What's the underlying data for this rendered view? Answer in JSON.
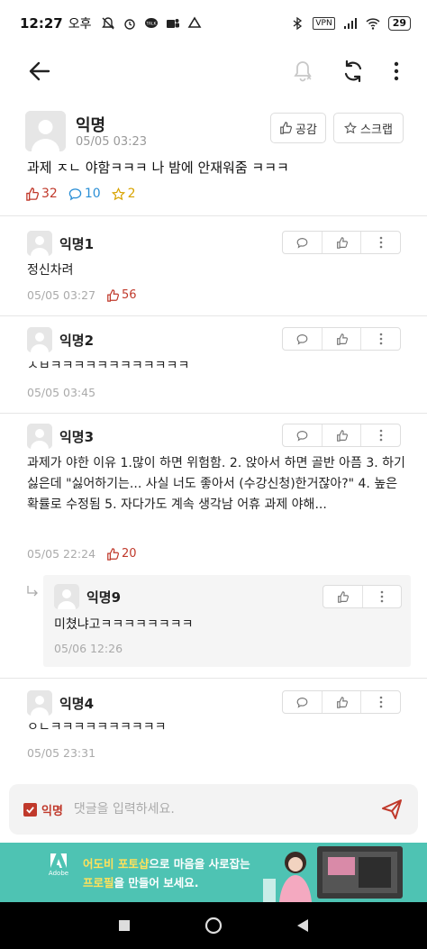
{
  "status_bar": {
    "time": "12:27",
    "ampm": "오후",
    "vpn": "VPN",
    "battery": "29"
  },
  "app_bar": {
    "icons": [
      "back-arrow-icon",
      "notification-off-icon",
      "refresh-icon",
      "more-vertical-icon"
    ]
  },
  "post": {
    "author": "익명",
    "date": "05/05 03:23",
    "like_button": "공감",
    "scrap_button": "스크랩",
    "body": "과제 ㅈㄴ 야함ㅋㅋㅋ 나 밤에 안재워줌 ㅋㅋㅋ",
    "likes": "32",
    "comments": "10",
    "scraps": "2"
  },
  "comments": [
    {
      "author": "익명1",
      "text": "정신차려",
      "date": "05/05 03:27",
      "likes": "56"
    },
    {
      "author": "익명2",
      "text": "ㅅㅂㅋㅋㅋㅋㅋㅋㅋㅋㅋㅋㅋㅋ",
      "date": "05/05 03:45",
      "likes": ""
    },
    {
      "author": "익명3",
      "text": "과제가 야한 이유 1.많이 하면 위험함. 2. 앉아서 하면 골반 아픔 3. 하기 싫은데 \"싫어하기는... 사실 너도 좋아서 (수강신청)한거잖아?\" 4. 높은 확률로 수정됨 5. 자다가도 계속 생각남 어휴 과제 야해...",
      "date": "05/05 22:24",
      "likes": "20"
    },
    {
      "author": "익명4",
      "text": "ㅇㄴㅋㅋㅋㅋㅋㅋㅋㅋㅋㅋ",
      "date": "05/05 23:31",
      "likes": ""
    }
  ],
  "reply": {
    "author": "익명9",
    "text": "미쳤냐고ㅋㅋㅋㅋㅋㅋㅋㅋ",
    "date": "05/06 12:26"
  },
  "comment_input": {
    "anonymous_label": "익명",
    "placeholder": "댓글을 입력하세요."
  },
  "ad": {
    "logo_text": "Adobe",
    "line1_a": "어도비 포토샵",
    "line1_b": "으로 마음을 사로잡는",
    "line2_a": "프로필",
    "line2_b": "을 만들어 보세요."
  },
  "colors": {
    "accent_red": "#c0392b",
    "comment_blue": "#2b8fd6",
    "scrap_yellow": "#d8a300",
    "ad_bg": "#4ec3b3"
  }
}
